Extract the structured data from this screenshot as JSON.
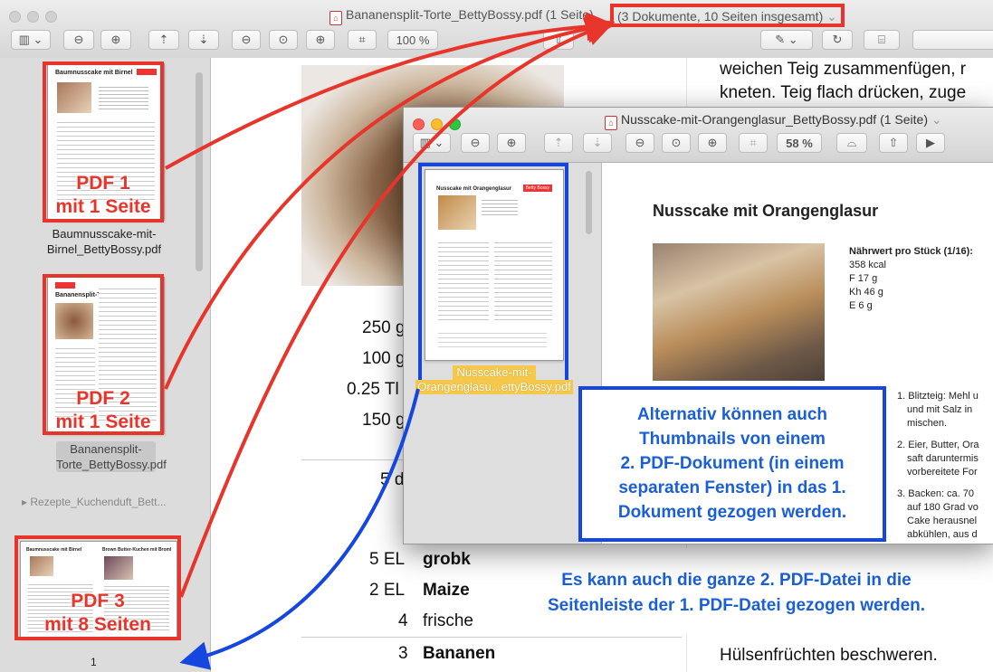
{
  "back_window": {
    "title": "Bananensplit-Torte_BettyBossy.pdf (1 Seite)",
    "title_extra": "(3 Dokumente, 10 Seiten insgesamt)",
    "zoom": "100 %",
    "sidebar": {
      "thumb1_title": "Baumnusscake mit Birnel",
      "thumb1_label": [
        "PDF 1",
        "mit 1 Seite"
      ],
      "file1": [
        "Baumnusscake-mit-",
        "Birnel_BettyBossy.pdf"
      ],
      "thumb2_title": "Bananensplit-Torte",
      "thumb2_label": [
        "PDF 2",
        "mit 1 Seite"
      ],
      "file2": [
        "Bananensplit-",
        "Torte_BettyBossy.pdf"
      ],
      "group3": "Rezepte_Kuchenduft_Bett...",
      "thumb3_title_left": "Baumnusscake mit Birnel",
      "thumb3_title_right": "Brown Butter-Kuchen mit Brombeeren",
      "thumb3_label": [
        "PDF 3",
        "mit 8 Seiten"
      ],
      "page_number": "1"
    },
    "doc": {
      "top_right_1": "weichen Teig zusammenfügen, r",
      "top_right_2": "kneten. Teig flach drücken, zuge",
      "ing_qty": [
        "250 g",
        "100 g",
        "0.25 Tl",
        "150 g"
      ],
      "five": "5 d",
      "rows": [
        {
          "qty": "5 EL",
          "name": "grobk"
        },
        {
          "qty": "2 EL",
          "name": "Maize"
        },
        {
          "qty": "4",
          "name": "frische"
        },
        {
          "qty": "3",
          "name": "Bananen"
        }
      ],
      "bottom_right": "Hülsenfrüchten beschweren.",
      "info_blue": [
        "Es kann auch die ganze 2. PDF-Datei in die",
        "Seitenleiste der 1. PDF-Datei gezogen werden."
      ]
    }
  },
  "front_window": {
    "title": "Nusscake-mit-Orangenglasur_BettyBossy.pdf (1 Seite)",
    "zoom": "58 %",
    "thumb_title": "Nusscake mit Orangenglasur",
    "thumb_badge": "Betty Bossy",
    "thumb_filename": [
      "Nusscake-mit-",
      "Orangenglasu...ettyBossy.pdf"
    ],
    "page": {
      "heading": "Nusscake mit Orangenglasur",
      "nutrition_title": "Nährwert pro Stück (1/16):",
      "nutrition": [
        "358 kcal",
        "F 17 g",
        "Kh 46 g",
        "E 6 g"
      ],
      "steps": [
        {
          "num": "1.",
          "lines": [
            "Blitzteig: Mehl u",
            "und mit Salz in",
            "mischen."
          ]
        },
        {
          "num": "2.",
          "lines": [
            "Eier, Butter, Ora",
            "saft daruntermis",
            "vorbereitete For"
          ]
        },
        {
          "num": "3.",
          "lines": [
            "Backen: ca. 70",
            "auf 180 Grad vo",
            "Cake herausnel",
            "abkühlen, aus d"
          ]
        }
      ]
    },
    "info_blue": [
      "Alternativ können auch",
      "Thumbnails von einem",
      "2. PDF-Dokument (in einem",
      "separaten Fenster) in das 1.",
      "Dokument gezogen werden."
    ]
  },
  "colors": {
    "red": "#e8352b",
    "blue": "#1546e0",
    "selection": "#f5c84c"
  }
}
